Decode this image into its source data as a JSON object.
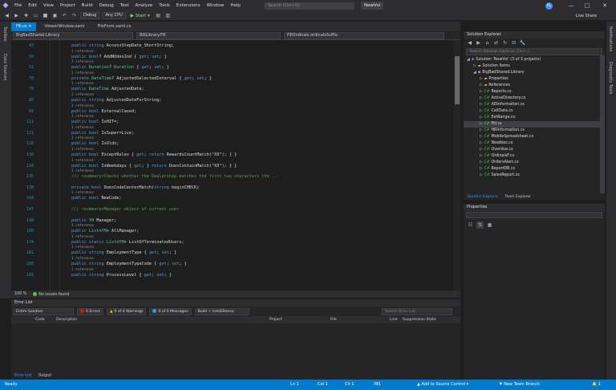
{
  "menubar": {
    "logo": "◆",
    "items": [
      "File",
      "Edit",
      "View",
      "Project",
      "Build",
      "Debug",
      "Test",
      "Analyze",
      "Tools",
      "Extensions",
      "Window",
      "Help"
    ],
    "search_placeholder": "Search (Ctrl+Q)",
    "solution_name": "NewVsi",
    "avatar_initials": "AL",
    "minimize": "—",
    "maximize": "□",
    "close": "✕"
  },
  "toolbar": {
    "config": "Debug",
    "platform": "Any CPU",
    "start_label": "▶ Start ▾",
    "live_share": "Live Share"
  },
  "left_strip": {
    "tab1": "Toolbox",
    "tab2": "Data Sources"
  },
  "doc_tabs": [
    {
      "label": "Fill.cs  ✕",
      "active": true
    },
    {
      "label": "ViewerWindow.xaml",
      "active": false
    },
    {
      "label": "FileForm.xaml.cs",
      "active": false
    }
  ],
  "nav_bar": {
    "project": "BigBadShared.Library",
    "class": "BillLibrary.Fill",
    "member": "FillOrdinals.ordinalsSuffix"
  },
  "editor": {
    "lines": [
      {
        "no": "43",
        "code": "public string AccessStepDate_ShortString;",
        "ref": "1 reference"
      },
      {
        "no": "50",
        "code": "public bool? AddNOdesInd { get; set; }",
        "ref": "1 reference"
      },
      {
        "no": "51",
        "code": "public Duration? Duration { get; set; }",
        "ref": "1 reference"
      },
      {
        "no": "70",
        "code": "private DateTime? AdjustedSelectedInterval { get; set; }",
        "ref": "1 reference"
      },
      {
        "no": "78",
        "code": "public DateTime AdjustedDate;",
        "ref": "1 reference"
      },
      {
        "no": "80",
        "code": "public string AdjustedDateForString;",
        "ref": "1 reference"
      },
      {
        "no": "84",
        "code": "public bool ExternalCased;",
        "ref": "1 reference"
      },
      {
        "no": "111",
        "code": "public bool IsHIT=;",
        "ref": "1 reference"
      },
      {
        "no": "121",
        "code": "public bool IsSuper=Live;",
        "ref": "1 reference"
      },
      {
        "no": "126",
        "code": "public bool IsOldx;",
        "ref": "1 reference"
      },
      {
        "no": "130",
        "code": "public bool ExceptRules { get; return RewardsCountMatch(\"XX\"); } }",
        "ref": "1 reference"
      },
      {
        "no": "134",
        "code": "public bool IsWeekdays { get; } return DoesContainMatch(\"XX\"); } }",
        "ref": "1 reference"
      },
      {
        "no": "135",
        "code": "/// <summary>Checks whether the Dealership matches the first two characters the ...",
        "ref": ""
      },
      {
        "no": "138",
        "code": "private bool DoesCodeCenterMatch(string beginCHECK)",
        "ref": "1 reference"
      },
      {
        "no": "144",
        "code": "public bool NewCode;",
        "ref": ""
      },
      {
        "no": "147",
        "code": "/// <summary>Manager object of current user",
        "ref": ""
      },
      {
        "no": "148",
        "code": "public YH Manager;",
        "ref": "1 reference"
      },
      {
        "no": "160",
        "code": "public List<YH> AllManager;",
        "ref": "1 reference"
      },
      {
        "no": "174",
        "code": "public static List<YH> ListOfTerminatedUsers;",
        "ref": "1 reference"
      },
      {
        "no": "181",
        "code": "public string EmploymentType { get; set; }",
        "ref": "1 reference"
      },
      {
        "no": "188",
        "code": "public string EmploymentTypeCode { get; set; }",
        "ref": "1 reference"
      },
      {
        "no": "191",
        "code": "public string ProcessLevel { get; set; }",
        "ref": ""
      }
    ]
  },
  "editor_status": {
    "zoom": "100 %",
    "issues": "No issues found"
  },
  "error_list": {
    "title": "Error List",
    "scope": "Entire Solution",
    "errors": "0 Errors",
    "warnings": "0 of 4 Warnings",
    "messages": "0 of 0 Messages",
    "build_filter": "Build + IntelliSense",
    "search_placeholder": "Search Error List",
    "columns": [
      "Code",
      "Description",
      "Project",
      "File",
      "Line",
      "Suppression State"
    ],
    "tabs": [
      "Error List",
      "Output"
    ]
  },
  "solution_explorer": {
    "title": "Solution Explorer",
    "search_placeholder": "Search Solution Explorer (Ctrl+;)",
    "items": [
      {
        "label": "Solution 'NewVsi' (3 of 3 projects)",
        "indent": 0,
        "icon": "sln",
        "selected": false
      },
      {
        "label": "Solution Items",
        "indent": 1,
        "icon": "folder",
        "selected": false
      },
      {
        "label": "BigBadShared.Library",
        "indent": 1,
        "icon": "proj",
        "selected": false
      },
      {
        "label": "Properties",
        "indent": 2,
        "icon": "folder",
        "selected": false
      },
      {
        "label": "References",
        "indent": 2,
        "icon": "folder",
        "selected": false
      },
      {
        "label": "Reports.cs",
        "indent": 2,
        "icon": "cs",
        "selected": false
      },
      {
        "label": "ActiveDirectory.cs",
        "indent": 2,
        "icon": "cs",
        "selected": false
      },
      {
        "label": "ADInformation.cs",
        "indent": 2,
        "icon": "cs",
        "selected": false
      },
      {
        "label": "CallData.cs",
        "indent": 2,
        "icon": "cs",
        "selected": false
      },
      {
        "label": "ExtRange.cs",
        "indent": 2,
        "icon": "cs",
        "selected": false
      },
      {
        "label": "Fill.cs",
        "indent": 2,
        "icon": "cs",
        "selected": true
      },
      {
        "label": "HRInformation.cs",
        "indent": 2,
        "icon": "cs",
        "selected": false
      },
      {
        "label": "MobileSpreadsheet.cs",
        "indent": 2,
        "icon": "cs",
        "selected": false
      },
      {
        "label": "Newbies.cs",
        "indent": 2,
        "icon": "cs",
        "selected": false
      },
      {
        "label": "Overdue.cs",
        "indent": 2,
        "icon": "cs",
        "selected": false
      },
      {
        "label": "OrdinalsF.cs",
        "indent": 2,
        "icon": "cs",
        "selected": false
      },
      {
        "label": "OrdersAlert.cs",
        "indent": 2,
        "icon": "cs",
        "selected": false
      },
      {
        "label": "ReportDB.cs",
        "indent": 2,
        "icon": "cs",
        "selected": false
      },
      {
        "label": "SalesReport.cs",
        "indent": 2,
        "icon": "cs",
        "selected": false
      }
    ],
    "tabs": [
      "Solution Explorer",
      "Team Explorer"
    ]
  },
  "properties": {
    "title": "Properties"
  },
  "right_strip": {
    "tab1": "Notifications",
    "tab2": "Diagnostic Tools"
  },
  "statusbar": {
    "ready": "Ready",
    "line": "Ln 1",
    "col": "Col 1",
    "ch": "Ch 1",
    "ins": "INS",
    "source_control": "▲ Add to Source Control ▾",
    "branch": "⚑ New Team Branch",
    "notifications": "🔔 1"
  },
  "colors": {
    "accent": "#007acc",
    "keyword": "#569cd6",
    "type": "#4ec9b0",
    "comment": "#57a64a"
  }
}
